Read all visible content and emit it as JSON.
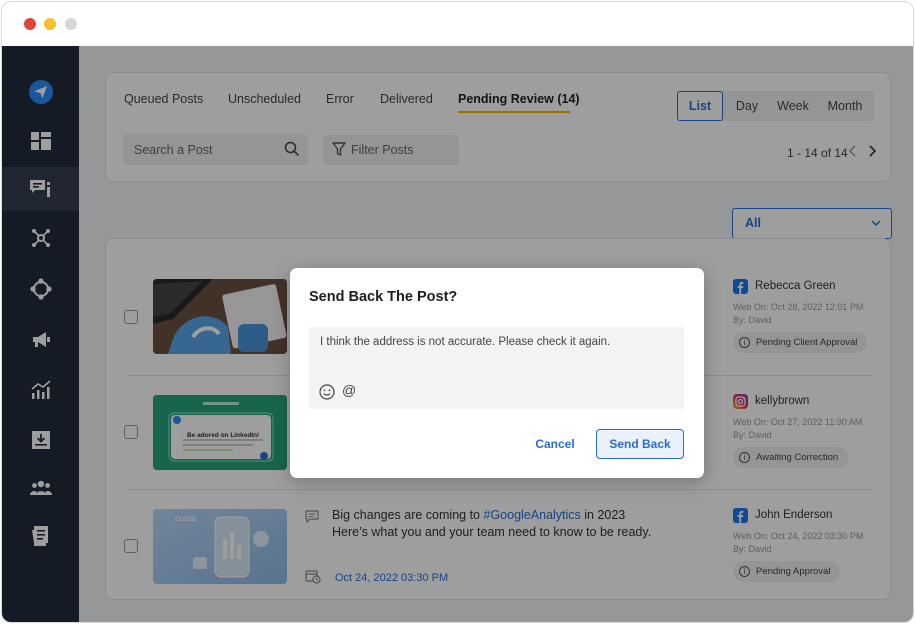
{
  "tabs": [
    {
      "label": "Queued Posts"
    },
    {
      "label": "Unscheduled"
    },
    {
      "label": "Error"
    },
    {
      "label": "Delivered"
    },
    {
      "label": "Pending Review (14)"
    }
  ],
  "views": [
    "List",
    "Day",
    "Week",
    "Month"
  ],
  "search": {
    "placeholder": "Search a Post"
  },
  "filter": {
    "label": "Filter Posts"
  },
  "pager": {
    "text": "1 - 14 of 14"
  },
  "account_filter": {
    "selected": "All"
  },
  "posts": [
    {
      "author": "Rebecca Green",
      "network": "facebook",
      "web_on": "Web On: Oct 28, 2022 12:01 PM",
      "by": "By: David",
      "status": "Pending Client Approval",
      "thumb_text": ""
    },
    {
      "author": "kellybrown",
      "network": "instagram",
      "web_on": "Web On: Oct 27, 2022 11:30 AM",
      "by": "By: David",
      "status": "Awaiting Correction",
      "thumb_text": "Be adored on LinkedIn!"
    },
    {
      "author": "John Enderson",
      "network": "facebook",
      "web_on": "Web On: Oct 24, 2022 03:30 PM",
      "by": "By: David",
      "status": "Pending Approval",
      "text_pre": "Big changes are coming to ",
      "text_tag": "#GoogleAnalytics",
      "text_post": " in 2023",
      "text_line2": "Here’s what you and your team need to know to be ready.",
      "date": "Oct 24, 2022 03:30 PM",
      "thumb_text": "CLOUD"
    }
  ],
  "modal": {
    "title": "Send Back The Post?",
    "message": "I think the address is not accurate. Please check it again.",
    "at_symbol": "@",
    "cancel_label": "Cancel",
    "send_label": "Send Back"
  },
  "colors": {
    "accent": "#2b6cd4",
    "sidebar": "#232c3d",
    "tab_underline": "#f0b400",
    "facebook": "#1877f2",
    "instagram": "#d6249f"
  },
  "sidebar_icons": [
    "send-icon",
    "dashboard-icon",
    "posts-icon",
    "network-icon",
    "integrations-icon",
    "megaphone-icon",
    "analytics-icon",
    "inbox-download-icon",
    "team-icon",
    "report-icon"
  ]
}
